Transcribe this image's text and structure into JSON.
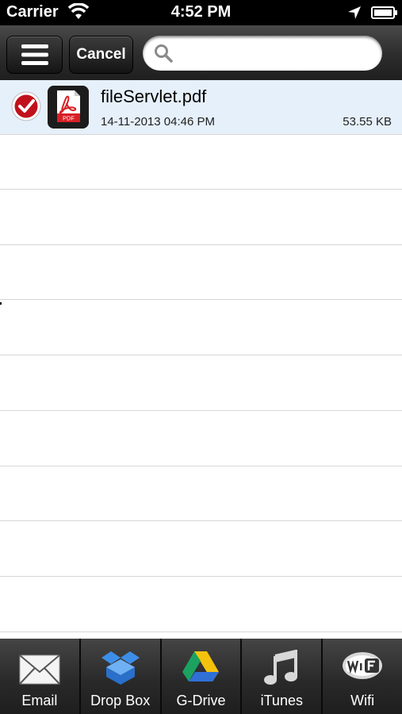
{
  "status_bar": {
    "carrier": "Carrier",
    "time": "4:52 PM"
  },
  "toolbar": {
    "cancel_label": "Cancel",
    "search_placeholder": "",
    "search_value": ""
  },
  "files": [
    {
      "name": "fileServlet.pdf",
      "date": "14-11-2013 04:46 PM",
      "size": "53.55 KB",
      "selected": true,
      "icon": "pdf-icon"
    }
  ],
  "tabs": [
    {
      "label": "Email",
      "icon": "envelope-icon"
    },
    {
      "label": "Drop Box",
      "icon": "dropbox-icon"
    },
    {
      "label": "G-Drive",
      "icon": "google-drive-icon"
    },
    {
      "label": "iTunes",
      "icon": "music-note-icon"
    },
    {
      "label": "Wifi",
      "icon": "wifi-badge-icon"
    }
  ],
  "colors": {
    "selected_row": "#e6f0fb",
    "check_red": "#c0101c",
    "pdf_red": "#d81f26"
  }
}
